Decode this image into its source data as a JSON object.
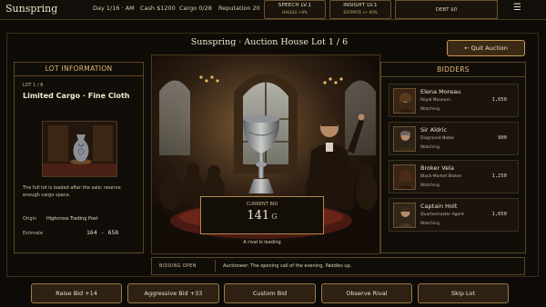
{
  "app": {
    "title": "Sunspring"
  },
  "status": {
    "day": "Day 1/16 · AM",
    "cash": "Cash $1200",
    "cargo": "Cargo 0/28",
    "reputation": "Reputation 20",
    "debt": "DEBT $0"
  },
  "skills": [
    {
      "title": "SPEECH LV.1",
      "sub": "HAGGLE +9%"
    },
    {
      "title": "INSIGHT LV.1",
      "sub": "ESTIMATE +/- 60%"
    }
  ],
  "menu_icon": "hamburger-menu-icon",
  "header": {
    "title": "Sunspring · Auction House   Lot 1 / 6",
    "quit_label": "← Quit Auction"
  },
  "lot": {
    "header": "LOT INFORMATION",
    "number": "LOT 1 / 6",
    "name": "Limited Cargo · Fine Cloth",
    "description": "The full lot is loaded after the sale; reserve enough cargo space.",
    "origin_label": "Origin",
    "origin_value": "Highcross Trading Post",
    "estimate_label": "Estimate",
    "estimate_value": "164 - 658"
  },
  "bid": {
    "caption": "CURRENT BID",
    "amount": "141",
    "unit": "G",
    "status": "A rival is leading"
  },
  "bidders": {
    "header": "BIDDERS",
    "list": [
      {
        "name": "Elena Moreau",
        "role": "Royal Museum",
        "status": "Watching",
        "bid": "1,050"
      },
      {
        "name": "Sir Aldric",
        "role": "Disgraced Noble",
        "status": "Watching",
        "bid": "900"
      },
      {
        "name": "Broker Vela",
        "role": "Black-Market Broker",
        "status": "Watching",
        "bid": "1,250"
      },
      {
        "name": "Captain Holt",
        "role": "Quartermaster Agent",
        "status": "Watching",
        "bid": "1,050"
      }
    ]
  },
  "log": {
    "tag": "BIDDING OPEN",
    "message": "Auctioneer: The opening call of the evening. Paddles up."
  },
  "actions": [
    {
      "label": "Raise Bid +14"
    },
    {
      "label": "Aggressive Bid +33"
    },
    {
      "label": "Custom Bid"
    },
    {
      "label": "Observe Rival"
    },
    {
      "label": "Skip Lot"
    }
  ],
  "colors": {
    "accent": "#c79a54",
    "panel": "#110d08",
    "bg": "#0d0a07"
  }
}
